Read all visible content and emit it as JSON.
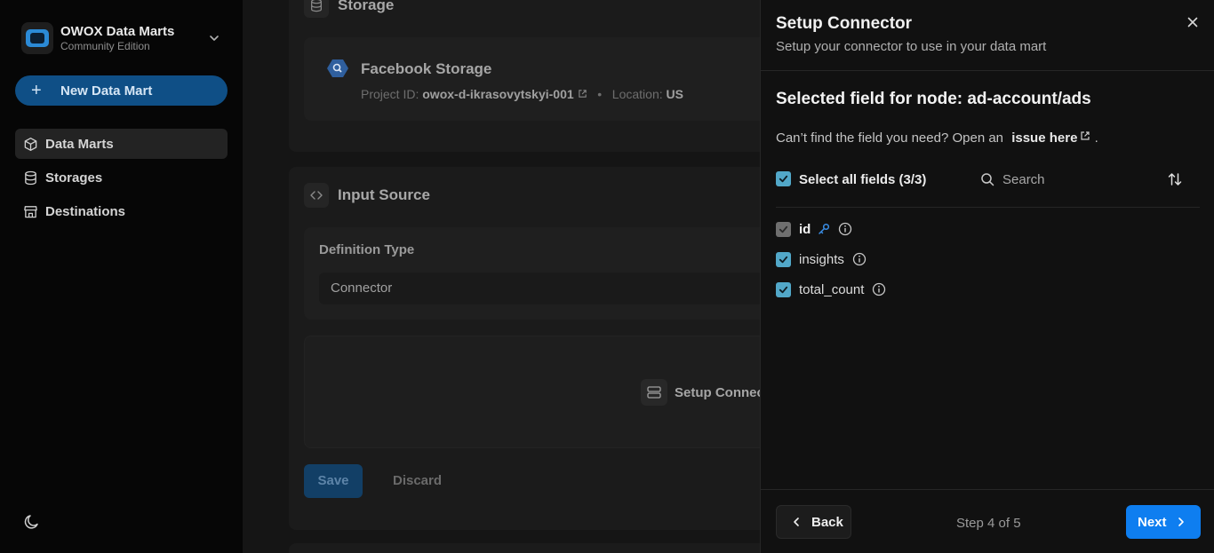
{
  "sidebar": {
    "brand_title": "OWOX Data Marts",
    "brand_subtitle": "Community Edition",
    "new_button": "New Data Mart",
    "items": [
      {
        "label": "Data Marts",
        "icon": "cube-icon",
        "active": true
      },
      {
        "label": "Storages",
        "icon": "database-icon",
        "active": false
      },
      {
        "label": "Destinations",
        "icon": "store-icon",
        "active": false
      }
    ],
    "theme_icon": "moon-icon"
  },
  "main": {
    "storage_section": {
      "title": "Storage",
      "name": "Facebook Storage",
      "project_label": "Project ID:",
      "project_id": "owox-d-ikrasovytskyi-001",
      "location_label": "Location:",
      "location": "US"
    },
    "input_section": {
      "title": "Input Source",
      "definition_label": "Definition Type",
      "definition_value": "Connector",
      "setup_button": "Setup Connect",
      "save": "Save",
      "discard": "Discard"
    }
  },
  "panel": {
    "title": "Setup Connector",
    "subtitle": "Setup your connector to use in your data mart",
    "node_title": "Selected field for node: ad-account/ads",
    "hint_text": "Can’t find the field you need? Open an",
    "hint_link": "issue here",
    "hint_end": ".",
    "select_all": "Select all fields (3/3)",
    "search_placeholder": "Search",
    "fields": [
      {
        "name": "id",
        "checked": true,
        "disabled": true,
        "primary_key": true
      },
      {
        "name": "insights",
        "checked": true,
        "disabled": false,
        "primary_key": false
      },
      {
        "name": "total_count",
        "checked": true,
        "disabled": false,
        "primary_key": false
      }
    ],
    "back": "Back",
    "step": "Step 4 of 5",
    "next": "Next"
  },
  "colors": {
    "accent": "#0e7ef0",
    "checkbox": "#52a8c9",
    "key_icon": "#3a8ee6"
  }
}
